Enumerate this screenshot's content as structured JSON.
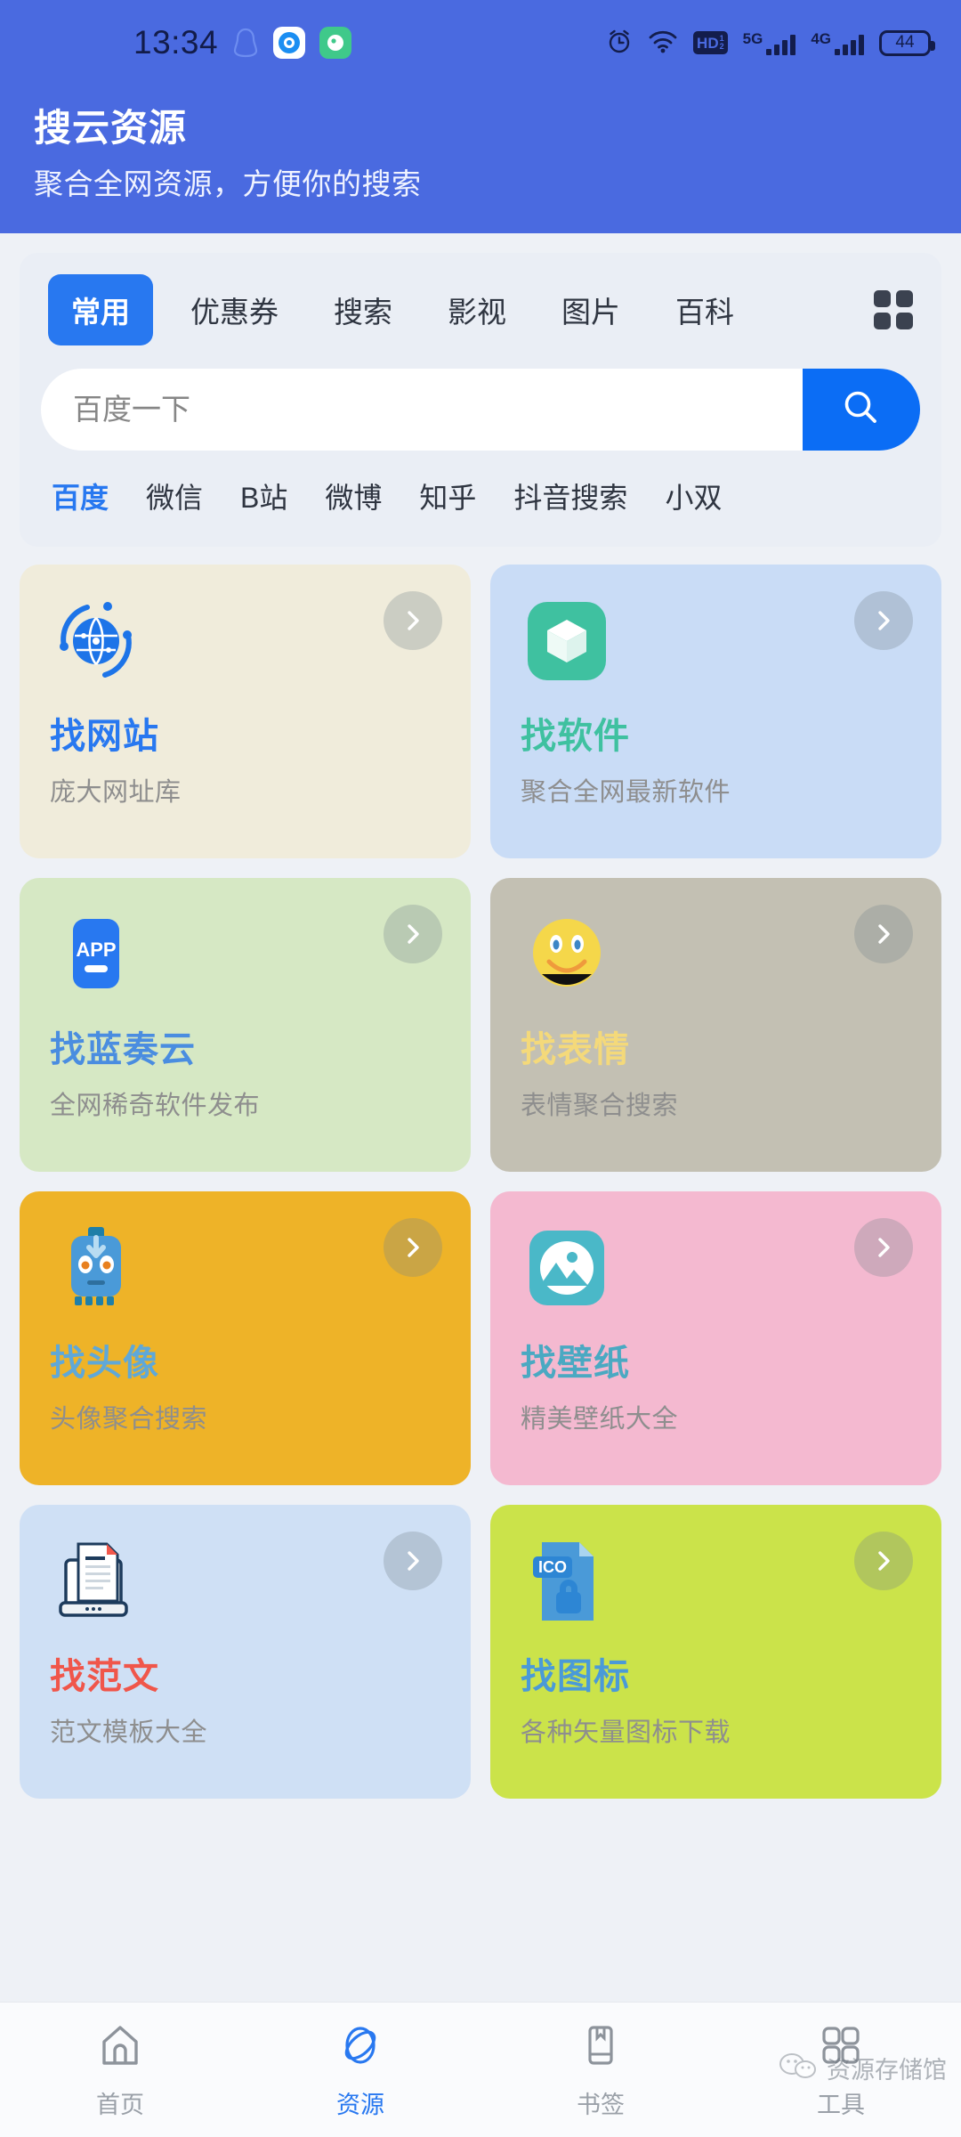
{
  "status_bar": {
    "time": "13:34",
    "icons_left": [
      "qq-icon",
      "camera-app-icon",
      "wechat-app-icon"
    ],
    "icons_right": [
      "alarm-icon",
      "wifi-icon",
      "hd-volte-icon",
      "5g-signal-icon",
      "4g-signal-icon",
      "battery-icon"
    ],
    "hd_label": "HD",
    "hd_sup": "1",
    "hd_sub": "2",
    "signal_5g_label": "5G",
    "signal_4g_label": "4G",
    "battery_level": "44"
  },
  "header": {
    "title": "搜云资源",
    "subtitle": "聚合全网资源，方便你的搜索",
    "bg_color": "#4a6ae0"
  },
  "search_panel": {
    "tabs": [
      {
        "label": "常用",
        "active": true
      },
      {
        "label": "优惠券",
        "active": false
      },
      {
        "label": "搜索",
        "active": false
      },
      {
        "label": "影视",
        "active": false
      },
      {
        "label": "图片",
        "active": false
      },
      {
        "label": "百科",
        "active": false
      }
    ],
    "grid_button": "grid-icon",
    "search": {
      "placeholder": "百度一下",
      "value": "",
      "button_icon": "search-icon",
      "button_color": "#0b6df5"
    },
    "quick_links": [
      {
        "label": "百度",
        "active": true
      },
      {
        "label": "微信",
        "active": false
      },
      {
        "label": "B站",
        "active": false
      },
      {
        "label": "微博",
        "active": false
      },
      {
        "label": "知乎",
        "active": false
      },
      {
        "label": "抖音搜索",
        "active": false
      },
      {
        "label": "小双",
        "active": false
      }
    ]
  },
  "cards": [
    {
      "title": "找网站",
      "subtitle": "庞大网址库",
      "bg": "#f0ecdb",
      "title_color": "#2878f0",
      "icon": "globe-network-icon",
      "arrow": "chevron-right-icon"
    },
    {
      "title": "找软件",
      "subtitle": "聚合全网最新软件",
      "bg": "#c9dcf6",
      "title_color": "#3fc1a0",
      "icon": "package-box-icon",
      "arrow": "chevron-right-icon"
    },
    {
      "title": "找蓝奏云",
      "subtitle": "全网稀奇软件发布",
      "bg": "#d6e8c4",
      "title_color": "#4a8de0",
      "icon": "app-badge-icon",
      "arrow": "chevron-right-icon"
    },
    {
      "title": "找表情",
      "subtitle": "表情聚合搜索",
      "bg": "#c3c0b3",
      "title_color": "#f4d97a",
      "icon": "smiley-face-icon",
      "arrow": "chevron-right-icon"
    },
    {
      "title": "找头像",
      "subtitle": "头像聚合搜索",
      "bg": "#eeb328",
      "title_color": "#5fa8d8",
      "icon": "robot-avatar-icon",
      "arrow": "chevron-right-icon"
    },
    {
      "title": "找壁纸",
      "subtitle": "精美壁纸大全",
      "bg": "#f4b9d0",
      "title_color": "#4aa9c2",
      "icon": "image-mountain-icon",
      "arrow": "chevron-right-icon"
    },
    {
      "title": "找范文",
      "subtitle": "范文模板大全",
      "bg": "#cfe0f5",
      "title_color": "#f0564a",
      "icon": "laptop-document-icon",
      "arrow": "chevron-right-icon"
    },
    {
      "title": "找图标",
      "subtitle": "各种矢量图标下载",
      "bg": "#cbe34a",
      "title_color": "#4a9ad8",
      "icon": "ico-file-icon",
      "arrow": "chevron-right-icon"
    }
  ],
  "bottom_nav": [
    {
      "label": "首页",
      "icon": "home-icon",
      "active": false
    },
    {
      "label": "资源",
      "icon": "planet-icon",
      "active": true
    },
    {
      "label": "书签",
      "icon": "bookmark-icon",
      "active": false
    },
    {
      "label": "工具",
      "icon": "grid-apps-icon",
      "active": false
    }
  ],
  "watermark": {
    "text": "资源存储馆",
    "icon": "wechat-bubbles-icon"
  }
}
